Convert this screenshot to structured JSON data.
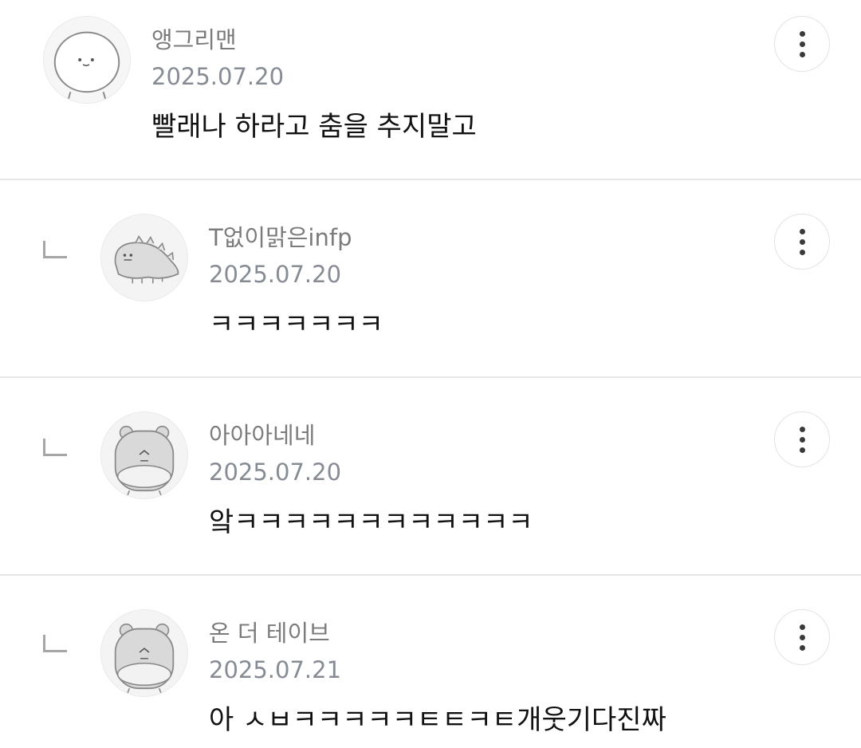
{
  "comments": [
    {
      "nickname": "앵그리맨",
      "date": "2025.07.20",
      "text": "빨래나 하라고 춤을 추지말고",
      "avatar_icon": "angry-face-icon",
      "is_reply": false
    },
    {
      "nickname": "T없이맑은infp",
      "date": "2025.07.20",
      "text": "ㅋㅋㅋㅋㅋㅋㅋ",
      "avatar_icon": "dinosaur-icon",
      "is_reply": true
    },
    {
      "nickname": "아아아네네",
      "date": "2025.07.20",
      "text": "앜ㅋㅋㅋㅋㅋㅋㅋㅋㅋㅋㅋㅋ",
      "avatar_icon": "hamster-icon",
      "is_reply": true
    },
    {
      "nickname": "온 더 테이브",
      "date": "2025.07.21",
      "text": "아 ㅅㅂㅋㅋㅋㅋㅋㅌㅌㅋㅌ개웃기다진짜",
      "avatar_icon": "hamster-icon",
      "is_reply": true
    }
  ],
  "colors": {
    "nickname": "#7b7b7b",
    "date": "#868b94",
    "text": "#111111",
    "divider": "#e6e6e6"
  }
}
